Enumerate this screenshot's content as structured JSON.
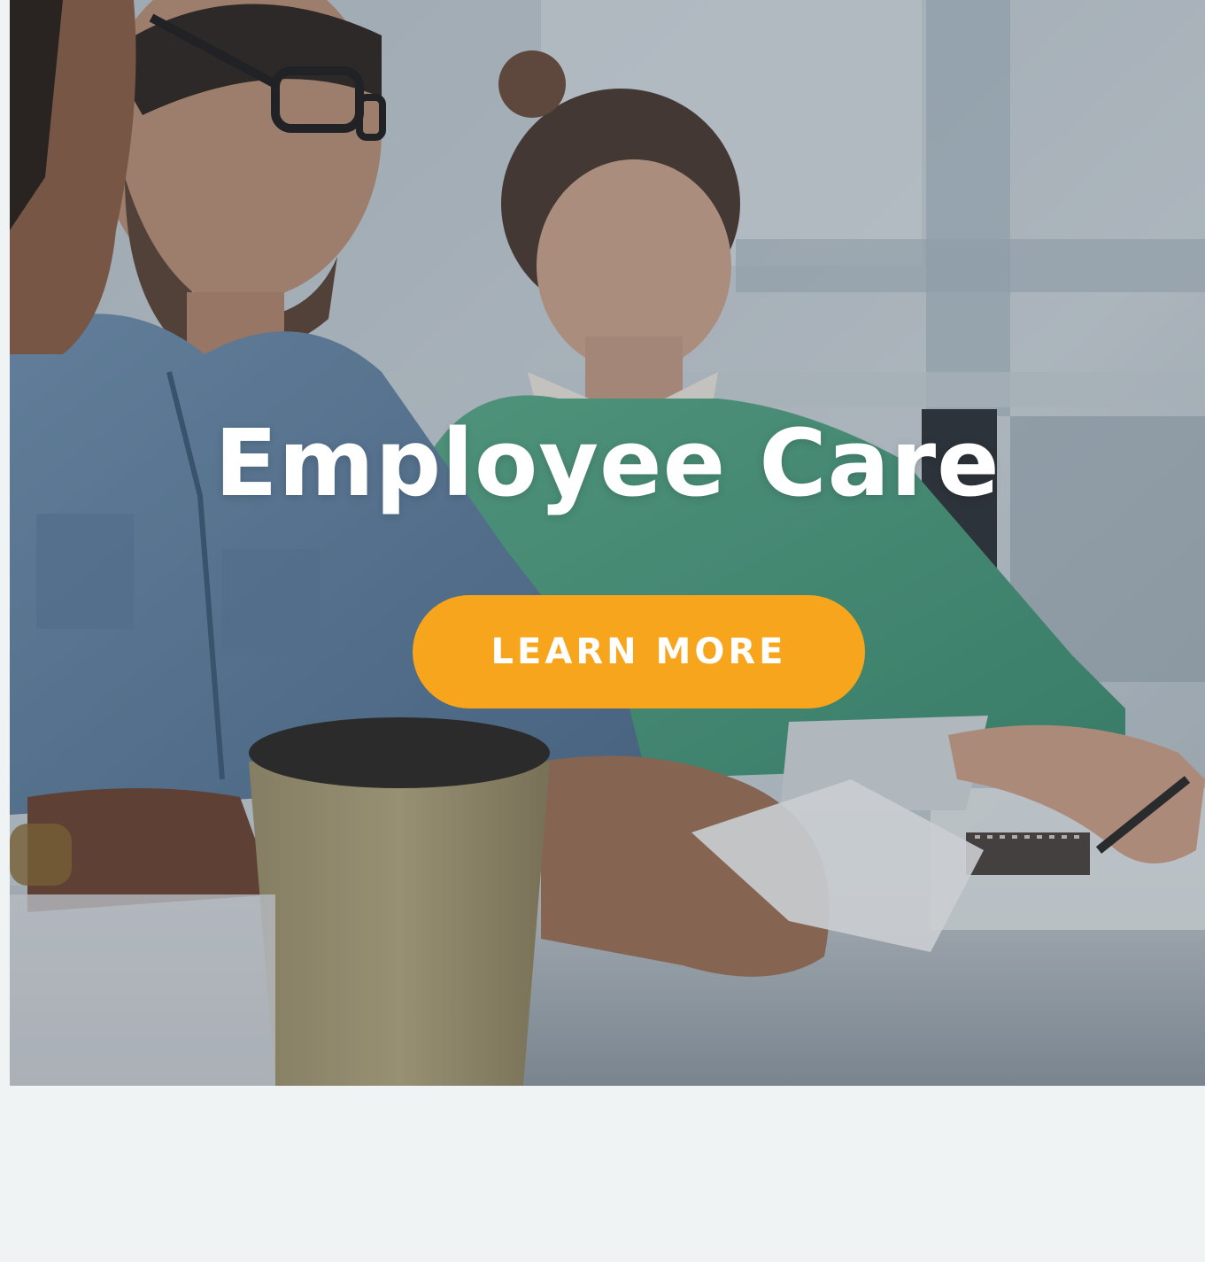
{
  "hero": {
    "title": "Employee Care",
    "image_description_icon": "team-meeting-photo",
    "cta_label": "LEARN MORE"
  },
  "colors": {
    "accent": "#f7a51d",
    "title_text": "#ffffff",
    "page_background": "#f0f3f3"
  }
}
